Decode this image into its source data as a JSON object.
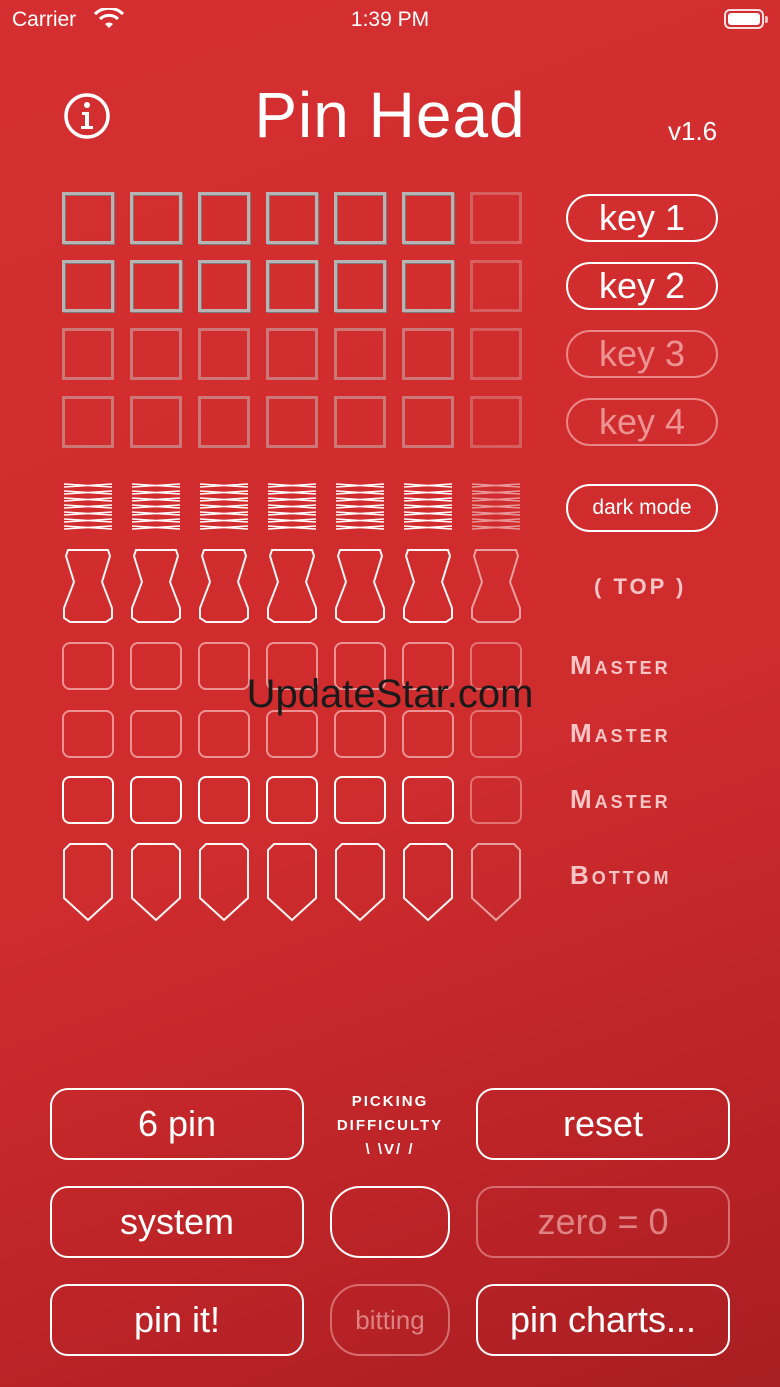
{
  "status_bar": {
    "carrier": "Carrier",
    "time": "1:39 PM"
  },
  "header": {
    "title": "Pin Head",
    "version": "v1.6",
    "info_icon": "info-circle-icon"
  },
  "keys": [
    {
      "label": "key 1",
      "state": "active"
    },
    {
      "label": "key 2",
      "state": "active"
    },
    {
      "label": "key 3",
      "state": "inactive"
    },
    {
      "label": "key 4",
      "state": "inactive"
    }
  ],
  "pin_columns": 7,
  "dark_mode_label": "dark mode",
  "rows": {
    "top": "( TOP )",
    "master_1": "Master",
    "master_2": "Master",
    "master_3": "Master",
    "bottom": "Bottom"
  },
  "watermark": "UpdateStar.com",
  "controls": {
    "pin_count": "6 pin",
    "difficulty_line1": "PICKING",
    "difficulty_line2": "DIFFICULTY",
    "difficulty_line3": "\\ \\V/ /",
    "reset": "reset",
    "system": "system",
    "blank": "",
    "zero": "zero = 0",
    "pin_it": "pin it!",
    "bitting": "bitting",
    "pin_charts": "pin charts..."
  },
  "colors": {
    "background": "#d12d2f",
    "foreground": "#ffffff"
  }
}
